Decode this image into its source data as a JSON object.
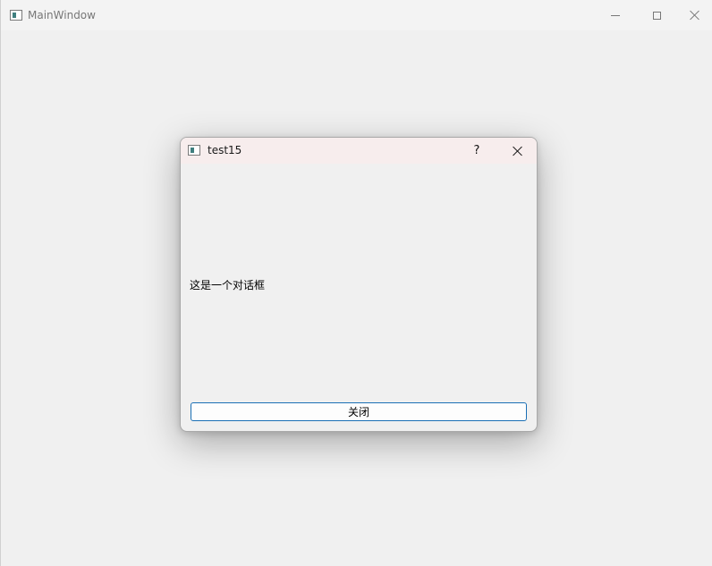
{
  "main_window": {
    "title": "MainWindow",
    "icon": "window-app-icon",
    "controls": {
      "minimize_icon": "minimize-icon",
      "maximize_icon": "maximize-icon",
      "close_icon": "close-icon"
    }
  },
  "dialog": {
    "title": "test15",
    "icon": "window-app-icon",
    "help_label": "?",
    "close_icon": "close-icon",
    "message": "这是一个对话框",
    "button_label": "关闭"
  },
  "colors": {
    "background": "#f0f0f0",
    "dialog_titlebar": "#f7eded",
    "button_border": "#1a6fb5"
  }
}
